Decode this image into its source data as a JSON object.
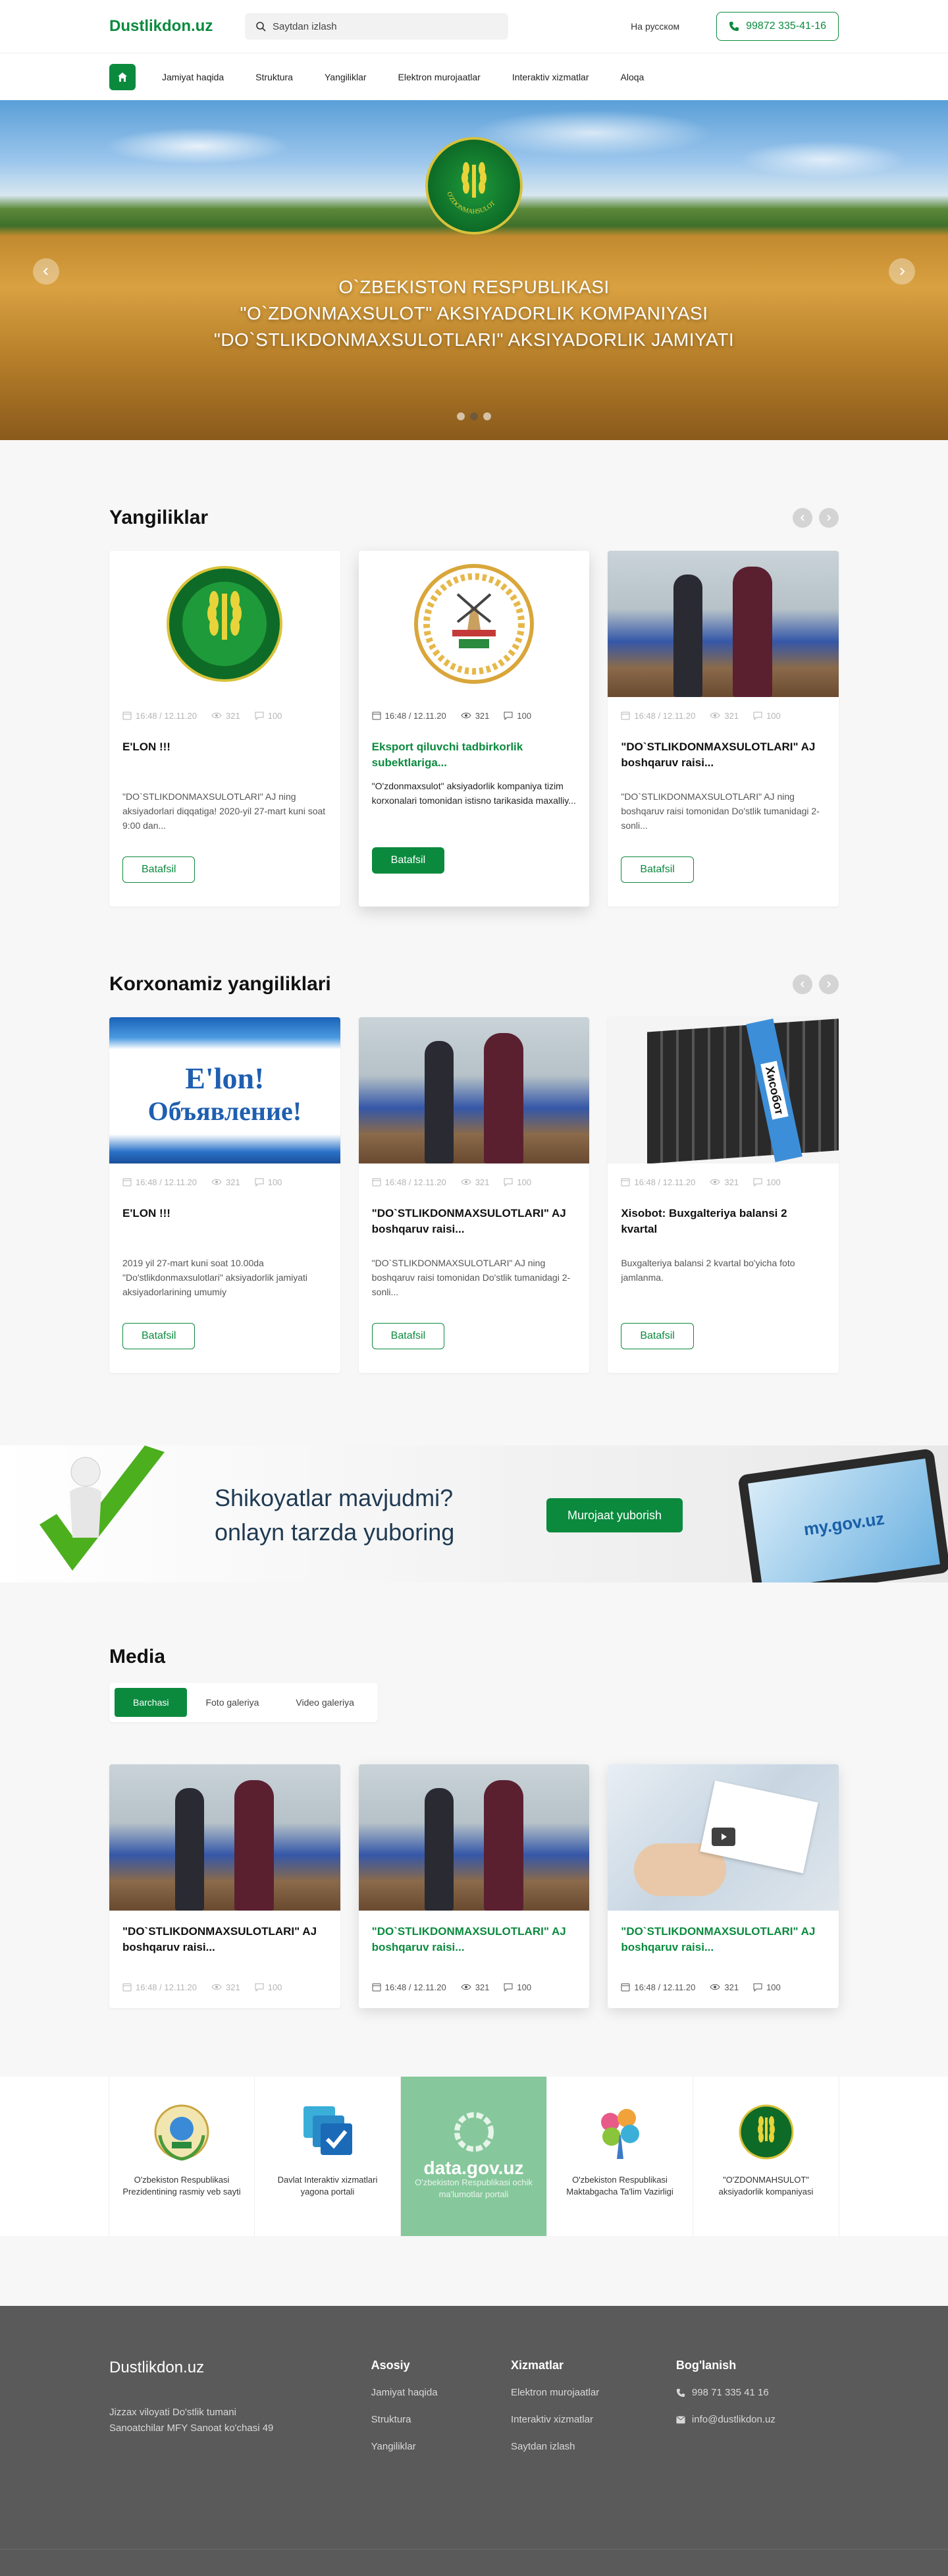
{
  "header": {
    "logo": "Dustlikdon.uz",
    "search_placeholder": "Saytdan izlash",
    "language": "На русском",
    "phone": "99872 335-41-16"
  },
  "nav": {
    "items": [
      "Jamiyat haqida",
      "Struktura",
      "Yangiliklar",
      "Elektron murojaatlar",
      "Interaktiv xizmatlar",
      "Aloqa"
    ]
  },
  "hero": {
    "line1": "O`ZBEKISTON RESPUBLIKASI",
    "line2": "\"O`ZDONMAXSULOT\" AKSIYADORLIK KOMPANIYASI",
    "line3": "\"DO`STLIKDONMAXSULOTLARI\" AKSIYADORLIK JAMIYATI",
    "emblem_text": "O'ZDONMAHSULOT"
  },
  "news": {
    "title": "Yangiliklar",
    "cards": [
      {
        "date": "16:48 / 12.11.20",
        "views": "321",
        "comments": "100",
        "title": "E'LON !!!",
        "text": "\"DO`STLIKDONMAXSULOTLARI\" AJ ning aksiyadorlari diqqatiga! 2020-yil 27-mart kuni soat 9:00 dan...",
        "button": "Batafsil"
      },
      {
        "date": "16:48 / 12.11.20",
        "views": "321",
        "comments": "100",
        "title": "Eksport qiluvchi tadbirkorlik subektlariga...",
        "text": "\"O'zdonmaxsulot\" aksiyadorlik kompaniya tizim korxonalari tomonidan istisno tarikasida maxalliy...",
        "button": "Batafsil"
      },
      {
        "date": "16:48 / 12.11.20",
        "views": "321",
        "comments": "100",
        "title": "\"DO`STLIKDONMAXSULOTLARI\" AJ boshqaruv raisi...",
        "text": "\"DO`STLIKDONMAXSULOTLARI\" AJ ning boshqaruv raisi tomonidan Do'stlik tumanidagi 2-sonli...",
        "button": "Batafsil"
      }
    ]
  },
  "company_news": {
    "title": "Korxonamiz yangiliklari",
    "cards": [
      {
        "date": "16:48 / 12.11.20",
        "views": "321",
        "comments": "100",
        "title": "E'LON !!!",
        "text": "2019 yil 27-mart kuni soat 10.00da \"Do'stlikdonmaxsulotlari\" aksiyadorlik jamiyati aksiyadorlarining umumiy",
        "button": "Batafsil",
        "image_text1": "E'lon!",
        "image_text2": "Объявление!"
      },
      {
        "date": "16:48 / 12.11.20",
        "views": "321",
        "comments": "100",
        "title": "\"DO`STLIKDONMAXSULOTLARI\" AJ boshqaruv raisi...",
        "text": "\"DO`STLIKDONMAXSULOTLARI\" AJ ning boshqaruv raisi tomonidan Do'stlik tumanidagi 2-sonli...",
        "button": "Batafsil"
      },
      {
        "date": "16:48 / 12.11.20",
        "views": "321",
        "comments": "100",
        "title": "Xisobot: Buxgalteriya balansi 2 kvartal",
        "text": "Buxgalteriya balansi 2 kvartal bo'yicha foto jamlanma.",
        "button": "Batafsil",
        "image_text": "Хисобот"
      }
    ]
  },
  "banner": {
    "line1": "Shikoyatlar mavjudmi?",
    "line2": "onlayn tarzda yuboring",
    "button": "Murojaat yuborish",
    "tablet_text": "my.gov.uz"
  },
  "media": {
    "title": "Media",
    "tabs": [
      "Barchasi",
      "Foto galeriya",
      "Video galeriya"
    ],
    "cards": [
      {
        "title": "\"DO`STLIKDONMAXSULOTLARI\" AJ boshqaruv raisi...",
        "date": "16:48 / 12.11.20",
        "views": "321",
        "comments": "100"
      },
      {
        "title": "\"DO`STLIKDONMAXSULOTLARI\" AJ boshqaruv raisi...",
        "date": "16:48 / 12.11.20",
        "views": "321",
        "comments": "100"
      },
      {
        "title": "\"DO`STLIKDONMAXSULOTLARI\" AJ boshqaruv raisi...",
        "date": "16:48 / 12.11.20",
        "views": "321",
        "comments": "100"
      }
    ]
  },
  "partners": [
    {
      "label": "O'zbekiston Respublikasi Prezidentining rasmiy veb sayti"
    },
    {
      "label": "Davlat Interaktiv xizmatlari yagona portali"
    },
    {
      "label": "O'zbekiston Respublikasi ochik ma'lumotlar portali",
      "logo_text": "data.gov.uz"
    },
    {
      "label": "O'zbekiston Respublikasi Maktabgacha Ta'lim Vazirligi"
    },
    {
      "label": "\"O'ZDONMAHSULOT\" aksiyadorlik kompaniyasi"
    }
  ],
  "footer": {
    "logo": "Dustlikdon.uz",
    "address_line1": "Jizzax viloyati Do'stlik tumani",
    "address_line2": "Sanoatchilar MFY Sanoat ko'chasi 49",
    "col1_title": "Asosiy",
    "col1": [
      "Jamiyat haqida",
      "Struktura",
      "Yangiliklar"
    ],
    "col2_title": "Xizmatlar",
    "col2": [
      "Elektron murojaatlar",
      "Interaktiv xizmatlar",
      "Saytdan izlash"
    ],
    "col3_title": "Bog'lanish",
    "phone": "998 71 335 41 16",
    "email": "info@dustlikdon.uz"
  },
  "colors": {
    "accent": "#0b8a3e",
    "footer": "#5a5a5a"
  }
}
